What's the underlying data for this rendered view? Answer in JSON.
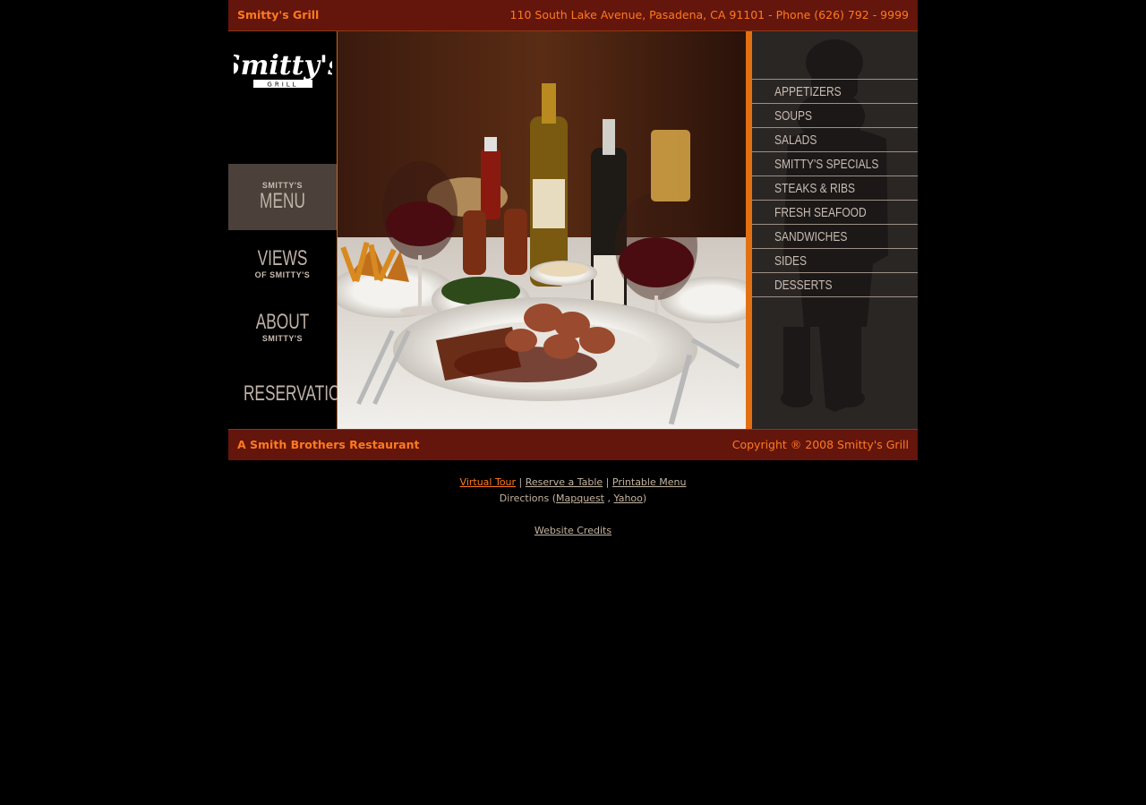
{
  "header": {
    "name": "Smitty's Grill",
    "address": "110 South Lake Avenue, Pasadena, CA 91101 - Phone (626) 792 - 9999"
  },
  "logo": {
    "main": "Smitty's",
    "sub": "GRILL"
  },
  "nav": {
    "menu": {
      "small": "SMITTY'S",
      "big": "MENU"
    },
    "views": {
      "big": "VIEWS",
      "small": "OF SMITTY'S"
    },
    "about": {
      "big": "ABOUT",
      "small": "SMITTY'S"
    },
    "reservations": {
      "big": "RESERVATIONS"
    }
  },
  "menu_items": [
    "APPETIZERS",
    "SOUPS",
    "SALADS",
    "SMITTY'S SPECIALS",
    "STEAKS & RIBS",
    "FRESH SEAFOOD",
    "SANDWICHES",
    "SIDES",
    "DESSERTS"
  ],
  "footer_bar": {
    "left": "A Smith Brothers Restaurant",
    "right": "Copyright ® 2008 Smitty's Grill"
  },
  "links": {
    "virtual_tour": "Virtual Tour",
    "reserve": "Reserve a Table",
    "printable_menu": "Printable Menu",
    "separator": "|",
    "directions_label": "Directions (",
    "mapquest": "Mapquest",
    "comma": ",",
    "yahoo": "Yahoo",
    "close_paren": ")",
    "credits": "Website Credits"
  },
  "colors": {
    "bar": "#64150c",
    "accent": "#ff7a1f",
    "menu_panel": "#2a2624"
  }
}
